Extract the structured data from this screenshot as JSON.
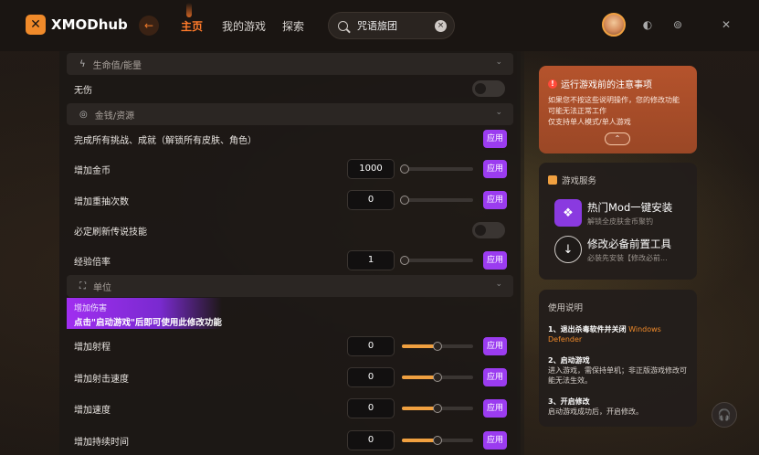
{
  "app": {
    "logo_text": "XMODhub"
  },
  "nav": {
    "home": "主页",
    "my_games": "我的游戏",
    "explore": "探索"
  },
  "search": {
    "value": "咒语旅团"
  },
  "sections": {
    "health": "生命值/能量",
    "money": "金钱/资源",
    "unit": "单位"
  },
  "rows": {
    "no_damage": "无伤",
    "complete_all": "完成所有挑战、成就（解锁所有皮肤、角色）",
    "add_gold": "增加金币",
    "add_gold_value": "1000",
    "add_reroll": "增加重抽次数",
    "add_reroll_value": "0",
    "legend_refresh": "必定刷新传说技能",
    "exp_mult": "经验倍率",
    "exp_mult_value": "1",
    "add_range": "增加射程",
    "add_range_value": "0",
    "add_attack_speed": "增加射击速度",
    "add_attack_speed_value": "0",
    "add_speed": "增加速度",
    "add_speed_value": "0",
    "add_duration": "增加持续时间",
    "add_duration_value": "0"
  },
  "apply_label": "应用",
  "banner": {
    "line1": "增加伤害",
    "line2": "点击\"启动游戏\"后即可使用此修改功能"
  },
  "notice": {
    "title": "运行游戏前的注意事项",
    "body1": "如果您不按这些说明操作，您的修改功能",
    "body2": "可能无法正常工作",
    "body3": "仅支持单人模式/单人游戏",
    "warn": "!"
  },
  "service": {
    "title": "游戏服务",
    "item1_name": "热门Mod一键安装",
    "item1_sub": "解锁全皮肤金币聚钓",
    "item2_name": "修改必备前置工具",
    "item2_sub": "必装先安装【修改必前..."
  },
  "instructions": {
    "title": "使用说明",
    "s1_title": "1、退出杀毒软件并关闭",
    "s1_hl": "Windows Defender",
    "s2_title": "2、启动游戏",
    "s2_body": "进入游戏，需保持单机；非正版游戏修改可能无法生效。",
    "s3_title": "3、开启修改",
    "s3_body": "启动游戏成功后，开启修改。"
  },
  "sliders": {
    "range": 0.5,
    "attack_speed": 0.5,
    "speed": 0.5,
    "duration": 0.5
  },
  "colors": {
    "accent": "#ff7a2a",
    "apply": "#9b3cf0",
    "notice": "#b5532c"
  }
}
